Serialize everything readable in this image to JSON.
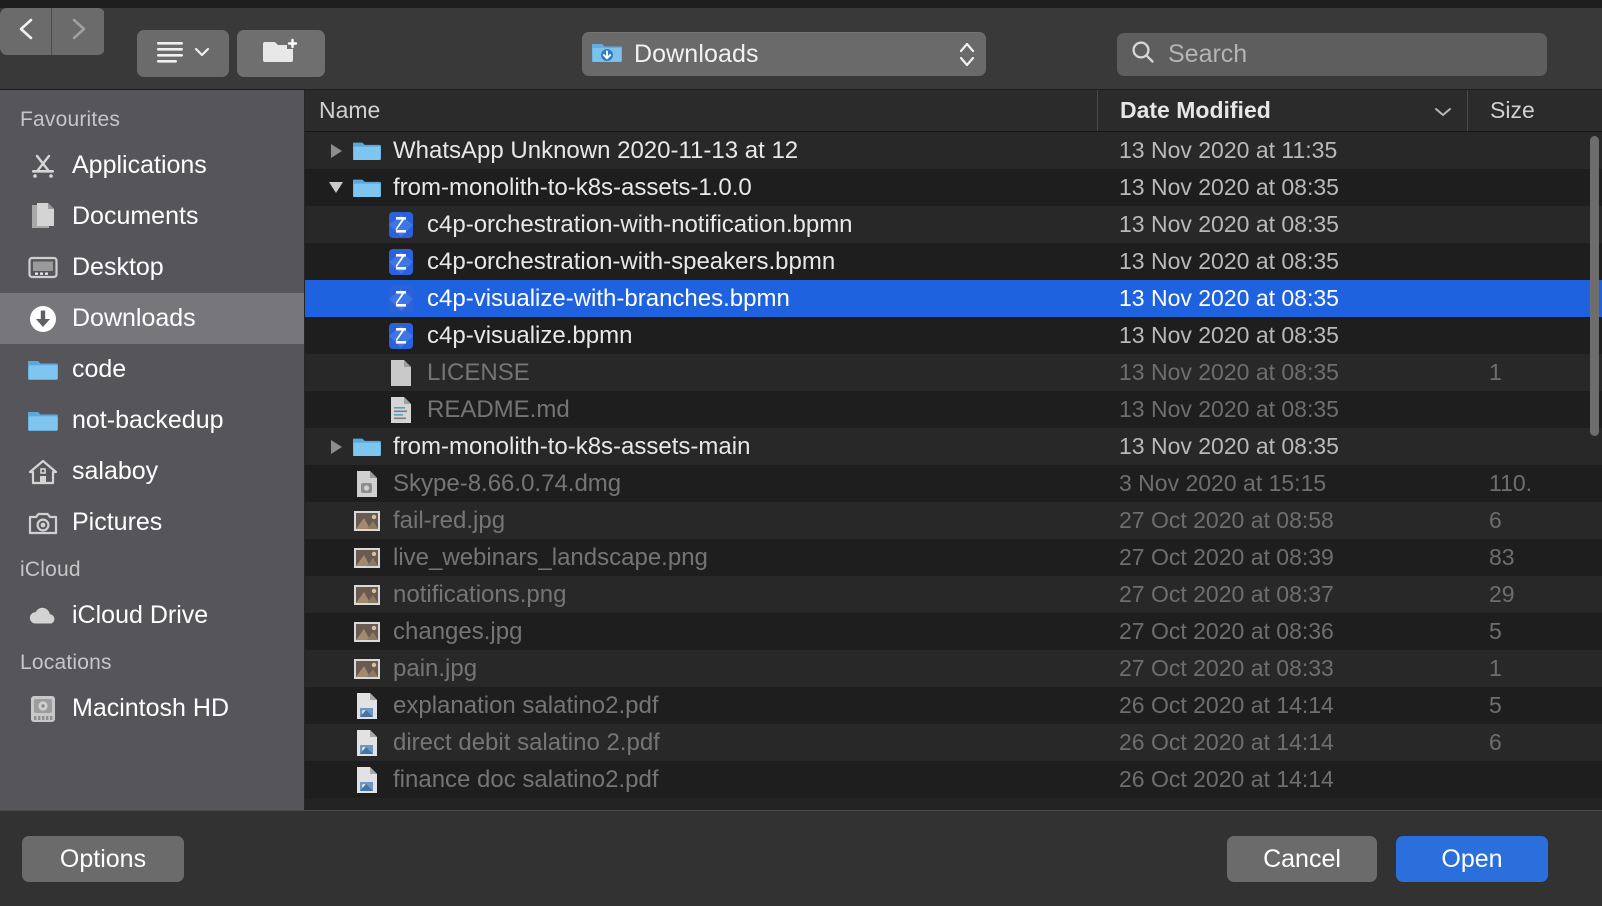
{
  "window": {
    "kind": "macos-open-file-dialog"
  },
  "colors": {
    "selection_blue": "#1f62df",
    "default_button_blue": "#2b6fdd",
    "sidebar_bg": "#56565a",
    "row_odd": "#282828",
    "row_even": "#1e1e1e",
    "folder_blue": "#6fb9e8",
    "bpmn_icon_blue": "#2b62d9"
  },
  "toolbar": {
    "back_icon": "chevron-left-icon",
    "forward_icon": "chevron-right-icon",
    "view_icon": "list-view-icon",
    "view_chevron_icon": "chevron-down-icon",
    "new_folder_icon": "new-folder-icon",
    "path": {
      "label": "Downloads",
      "icon": "downloads-folder-icon",
      "stepper_icon": "up-down-stepper-icon"
    },
    "search": {
      "icon": "search-icon",
      "value": "",
      "placeholder": "Search"
    }
  },
  "sidebar": {
    "sections": [
      {
        "title": "Favourites",
        "items": [
          {
            "label": "Applications",
            "icon": "applications-icon",
            "selected": false
          },
          {
            "label": "Documents",
            "icon": "documents-icon",
            "selected": false
          },
          {
            "label": "Desktop",
            "icon": "desktop-icon",
            "selected": false
          },
          {
            "label": "Downloads",
            "icon": "downloads-icon",
            "selected": true
          },
          {
            "label": "code",
            "icon": "folder-icon",
            "selected": false
          },
          {
            "label": "not-backedup",
            "icon": "folder-icon",
            "selected": false
          },
          {
            "label": "salaboy",
            "icon": "home-icon",
            "selected": false
          },
          {
            "label": "Pictures",
            "icon": "pictures-icon",
            "selected": false
          }
        ]
      },
      {
        "title": "iCloud",
        "items": [
          {
            "label": "iCloud Drive",
            "icon": "icloud-icon",
            "selected": false
          }
        ]
      },
      {
        "title": "Locations",
        "items": [
          {
            "label": "Macintosh HD",
            "icon": "harddisk-icon",
            "selected": false
          }
        ]
      }
    ]
  },
  "filelist": {
    "columns": {
      "name": "Name",
      "date_modified": "Date Modified",
      "size": "Size",
      "sort_chevron_icon": "chevron-down-icon",
      "sorted_by": "Date Modified"
    },
    "rows": [
      {
        "name": "WhatsApp Unknown 2020-11-13 at 12",
        "date": "13 Nov 2020 at 11:35",
        "size": "",
        "icon": "folder-icon",
        "twisty": "right",
        "indent": 0,
        "dim": false,
        "selected": false
      },
      {
        "name": "from-monolith-to-k8s-assets-1.0.0",
        "date": "13 Nov 2020 at 08:35",
        "size": "",
        "icon": "folder-icon",
        "twisty": "down",
        "indent": 0,
        "dim": false,
        "selected": false
      },
      {
        "name": "c4p-orchestration-with-notification.bpmn",
        "date": "13 Nov 2020 at 08:35",
        "size": "",
        "icon": "bpmn-file-icon",
        "twisty": "none",
        "indent": 1,
        "dim": false,
        "selected": false
      },
      {
        "name": "c4p-orchestration-with-speakers.bpmn",
        "date": "13 Nov 2020 at 08:35",
        "size": "",
        "icon": "bpmn-file-icon",
        "twisty": "none",
        "indent": 1,
        "dim": false,
        "selected": false
      },
      {
        "name": "c4p-visualize-with-branches.bpmn",
        "date": "13 Nov 2020 at 08:35",
        "size": "",
        "icon": "bpmn-file-icon",
        "twisty": "none",
        "indent": 1,
        "dim": false,
        "selected": true
      },
      {
        "name": "c4p-visualize.bpmn",
        "date": "13 Nov 2020 at 08:35",
        "size": "",
        "icon": "bpmn-file-icon",
        "twisty": "none",
        "indent": 1,
        "dim": false,
        "selected": false
      },
      {
        "name": "LICENSE",
        "date": "13 Nov 2020 at 08:35",
        "size": "1",
        "icon": "plain-document-icon",
        "twisty": "none",
        "indent": 1,
        "dim": true,
        "selected": false
      },
      {
        "name": "README.md",
        "date": "13 Nov 2020 at 08:35",
        "size": "",
        "icon": "markdown-document-icon",
        "twisty": "none",
        "indent": 1,
        "dim": true,
        "selected": false
      },
      {
        "name": "from-monolith-to-k8s-assets-main",
        "date": "13 Nov 2020 at 08:35",
        "size": "",
        "icon": "folder-icon",
        "twisty": "right",
        "indent": 0,
        "dim": false,
        "selected": false
      },
      {
        "name": "Skype-8.66.0.74.dmg",
        "date": "3 Nov 2020 at 15:15",
        "size": "110.",
        "icon": "dmg-icon",
        "twisty": "none",
        "indent": 0,
        "dim": true,
        "selected": false
      },
      {
        "name": "fail-red.jpg",
        "date": "27 Oct 2020 at 08:58",
        "size": "6",
        "icon": "image-thumbnail-icon",
        "twisty": "none",
        "indent": 0,
        "dim": true,
        "selected": false
      },
      {
        "name": "live_webinars_landscape.png",
        "date": "27 Oct 2020 at 08:39",
        "size": "83",
        "icon": "image-thumbnail-icon",
        "twisty": "none",
        "indent": 0,
        "dim": true,
        "selected": false
      },
      {
        "name": "notifications.png",
        "date": "27 Oct 2020 at 08:37",
        "size": "29",
        "icon": "image-thumbnail-icon",
        "twisty": "none",
        "indent": 0,
        "dim": true,
        "selected": false
      },
      {
        "name": "changes.jpg",
        "date": "27 Oct 2020 at 08:36",
        "size": "5",
        "icon": "image-thumbnail-icon",
        "twisty": "none",
        "indent": 0,
        "dim": true,
        "selected": false
      },
      {
        "name": "pain.jpg",
        "date": "27 Oct 2020 at 08:33",
        "size": "1",
        "icon": "image-thumbnail-icon",
        "twisty": "none",
        "indent": 0,
        "dim": true,
        "selected": false
      },
      {
        "name": "explanation salatino2.pdf",
        "date": "26 Oct 2020 at 14:14",
        "size": "5",
        "icon": "pdf-document-icon",
        "twisty": "none",
        "indent": 0,
        "dim": true,
        "selected": false
      },
      {
        "name": "direct debit salatino 2.pdf",
        "date": "26 Oct 2020 at 14:14",
        "size": "6",
        "icon": "pdf-document-icon",
        "twisty": "none",
        "indent": 0,
        "dim": true,
        "selected": false
      },
      {
        "name": "finance doc salatino2.pdf",
        "date": "26 Oct 2020 at 14:14",
        "size": "",
        "icon": "pdf-document-icon",
        "twisty": "none",
        "indent": 0,
        "dim": true,
        "selected": false
      }
    ]
  },
  "footer": {
    "options_label": "Options",
    "cancel_label": "Cancel",
    "open_label": "Open"
  }
}
